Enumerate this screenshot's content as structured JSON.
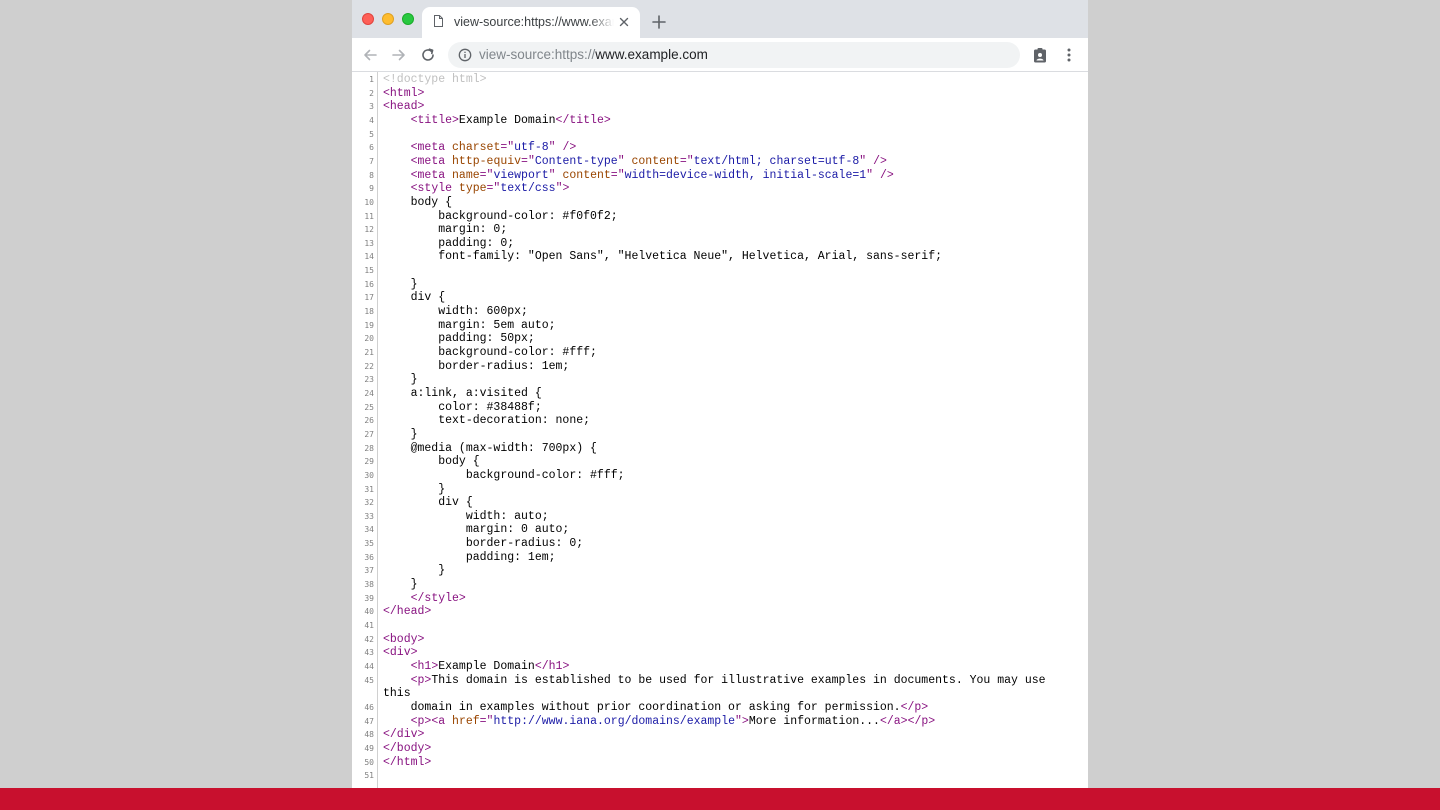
{
  "colors": {
    "tag": "#881280",
    "attribute": "#994500",
    "value": "#1a1aa6",
    "doctype": "#c0c0c0",
    "accent_bar": "#c8102e"
  },
  "browser": {
    "tab": {
      "title": "view-source:https://www.example.com",
      "icon": "document-icon",
      "close_icon": "close-icon"
    },
    "new_tab_icon": "plus-icon",
    "toolbar": {
      "back_icon": "arrow-left-icon",
      "forward_icon": "arrow-right-icon",
      "reload_icon": "reload-icon",
      "url_prefix": "view-source:https://",
      "url_host": "www.example.com",
      "site_info_icon": "info-icon",
      "extension_icon": "clipboard-person-icon",
      "menu_icon": "kebab-menu-icon"
    }
  },
  "source": {
    "lines": [
      {
        "n": "1",
        "segs": [
          {
            "t": "<!doctype html>",
            "c": "doct"
          }
        ]
      },
      {
        "n": "2",
        "segs": [
          {
            "t": "<html>",
            "c": "tag"
          }
        ]
      },
      {
        "n": "3",
        "segs": [
          {
            "t": "<head>",
            "c": "tag"
          }
        ]
      },
      {
        "n": "4",
        "segs": [
          {
            "t": "    "
          },
          {
            "t": "<title>",
            "c": "tag"
          },
          {
            "t": "Example Domain"
          },
          {
            "t": "</title>",
            "c": "tag"
          }
        ]
      },
      {
        "n": "5",
        "segs": []
      },
      {
        "n": "6",
        "segs": [
          {
            "t": "    "
          },
          {
            "t": "<meta ",
            "c": "tag"
          },
          {
            "t": "charset",
            "c": "att"
          },
          {
            "t": "=\"",
            "c": "tag"
          },
          {
            "t": "utf-8",
            "c": "val"
          },
          {
            "t": "\" />",
            "c": "tag"
          }
        ]
      },
      {
        "n": "7",
        "segs": [
          {
            "t": "    "
          },
          {
            "t": "<meta ",
            "c": "tag"
          },
          {
            "t": "http-equiv",
            "c": "att"
          },
          {
            "t": "=\"",
            "c": "tag"
          },
          {
            "t": "Content-type",
            "c": "val"
          },
          {
            "t": "\" ",
            "c": "tag"
          },
          {
            "t": "content",
            "c": "att"
          },
          {
            "t": "=\"",
            "c": "tag"
          },
          {
            "t": "text/html; charset=utf-8",
            "c": "val"
          },
          {
            "t": "\" />",
            "c": "tag"
          }
        ]
      },
      {
        "n": "8",
        "segs": [
          {
            "t": "    "
          },
          {
            "t": "<meta ",
            "c": "tag"
          },
          {
            "t": "name",
            "c": "att"
          },
          {
            "t": "=\"",
            "c": "tag"
          },
          {
            "t": "viewport",
            "c": "val"
          },
          {
            "t": "\" ",
            "c": "tag"
          },
          {
            "t": "content",
            "c": "att"
          },
          {
            "t": "=\"",
            "c": "tag"
          },
          {
            "t": "width=device-width, initial-scale=1",
            "c": "val"
          },
          {
            "t": "\" />",
            "c": "tag"
          }
        ]
      },
      {
        "n": "9",
        "segs": [
          {
            "t": "    "
          },
          {
            "t": "<style ",
            "c": "tag"
          },
          {
            "t": "type",
            "c": "att"
          },
          {
            "t": "=\"",
            "c": "tag"
          },
          {
            "t": "text/css",
            "c": "val"
          },
          {
            "t": "\">",
            "c": "tag"
          }
        ]
      },
      {
        "n": "10",
        "segs": [
          {
            "t": "    body {"
          }
        ]
      },
      {
        "n": "11",
        "segs": [
          {
            "t": "        background-color: #f0f0f2;"
          }
        ]
      },
      {
        "n": "12",
        "segs": [
          {
            "t": "        margin: 0;"
          }
        ]
      },
      {
        "n": "13",
        "segs": [
          {
            "t": "        padding: 0;"
          }
        ]
      },
      {
        "n": "14",
        "segs": [
          {
            "t": "        font-family: \"Open Sans\", \"Helvetica Neue\", Helvetica, Arial, sans-serif;"
          }
        ]
      },
      {
        "n": "15",
        "segs": []
      },
      {
        "n": "16",
        "segs": [
          {
            "t": "    }"
          }
        ]
      },
      {
        "n": "17",
        "segs": [
          {
            "t": "    div {"
          }
        ]
      },
      {
        "n": "18",
        "segs": [
          {
            "t": "        width: 600px;"
          }
        ]
      },
      {
        "n": "19",
        "segs": [
          {
            "t": "        margin: 5em auto;"
          }
        ]
      },
      {
        "n": "20",
        "segs": [
          {
            "t": "        padding: 50px;"
          }
        ]
      },
      {
        "n": "21",
        "segs": [
          {
            "t": "        background-color: #fff;"
          }
        ]
      },
      {
        "n": "22",
        "segs": [
          {
            "t": "        border-radius: 1em;"
          }
        ]
      },
      {
        "n": "23",
        "segs": [
          {
            "t": "    }"
          }
        ]
      },
      {
        "n": "24",
        "segs": [
          {
            "t": "    a:link, a:visited {"
          }
        ]
      },
      {
        "n": "25",
        "segs": [
          {
            "t": "        color: #38488f;"
          }
        ]
      },
      {
        "n": "26",
        "segs": [
          {
            "t": "        text-decoration: none;"
          }
        ]
      },
      {
        "n": "27",
        "segs": [
          {
            "t": "    }"
          }
        ]
      },
      {
        "n": "28",
        "segs": [
          {
            "t": "    @media (max-width: 700px) {"
          }
        ]
      },
      {
        "n": "29",
        "segs": [
          {
            "t": "        body {"
          }
        ]
      },
      {
        "n": "30",
        "segs": [
          {
            "t": "            background-color: #fff;"
          }
        ]
      },
      {
        "n": "31",
        "segs": [
          {
            "t": "        }"
          }
        ]
      },
      {
        "n": "32",
        "segs": [
          {
            "t": "        div {"
          }
        ]
      },
      {
        "n": "33",
        "segs": [
          {
            "t": "            width: auto;"
          }
        ]
      },
      {
        "n": "34",
        "segs": [
          {
            "t": "            margin: 0 auto;"
          }
        ]
      },
      {
        "n": "35",
        "segs": [
          {
            "t": "            border-radius: 0;"
          }
        ]
      },
      {
        "n": "36",
        "segs": [
          {
            "t": "            padding: 1em;"
          }
        ]
      },
      {
        "n": "37",
        "segs": [
          {
            "t": "        }"
          }
        ]
      },
      {
        "n": "38",
        "segs": [
          {
            "t": "    }"
          }
        ]
      },
      {
        "n": "39",
        "segs": [
          {
            "t": "    "
          },
          {
            "t": "</style>",
            "c": "tag"
          }
        ]
      },
      {
        "n": "40",
        "segs": [
          {
            "t": "</head>",
            "c": "tag"
          }
        ]
      },
      {
        "n": "41",
        "segs": []
      },
      {
        "n": "42",
        "segs": [
          {
            "t": "<body>",
            "c": "tag"
          }
        ]
      },
      {
        "n": "43",
        "segs": [
          {
            "t": "<div>",
            "c": "tag"
          }
        ]
      },
      {
        "n": "44",
        "segs": [
          {
            "t": "    "
          },
          {
            "t": "<h1>",
            "c": "tag"
          },
          {
            "t": "Example Domain"
          },
          {
            "t": "</h1>",
            "c": "tag"
          }
        ]
      },
      {
        "n": "45",
        "segs": [
          {
            "t": "    "
          },
          {
            "t": "<p>",
            "c": "tag"
          },
          {
            "t": "This domain is established to be used for illustrative examples in documents. You may use"
          }
        ]
      },
      {
        "n": "",
        "segs": [
          {
            "t": "this"
          }
        ]
      },
      {
        "n": "46",
        "segs": [
          {
            "t": "    domain in examples without prior coordination or asking for permission."
          },
          {
            "t": "</p>",
            "c": "tag"
          }
        ]
      },
      {
        "n": "47",
        "segs": [
          {
            "t": "    "
          },
          {
            "t": "<p>",
            "c": "tag"
          },
          {
            "t": "<a ",
            "c": "tag"
          },
          {
            "t": "href",
            "c": "att"
          },
          {
            "t": "=\"",
            "c": "tag"
          },
          {
            "t": "http://www.iana.org/domains/example",
            "c": "val"
          },
          {
            "t": "\">",
            "c": "tag"
          },
          {
            "t": "More information..."
          },
          {
            "t": "</a>",
            "c": "tag"
          },
          {
            "t": "</p>",
            "c": "tag"
          }
        ]
      },
      {
        "n": "48",
        "segs": [
          {
            "t": "</div>",
            "c": "tag"
          }
        ]
      },
      {
        "n": "49",
        "segs": [
          {
            "t": "</body>",
            "c": "tag"
          }
        ]
      },
      {
        "n": "50",
        "segs": [
          {
            "t": "</html>",
            "c": "tag"
          }
        ]
      },
      {
        "n": "51",
        "segs": []
      }
    ]
  }
}
